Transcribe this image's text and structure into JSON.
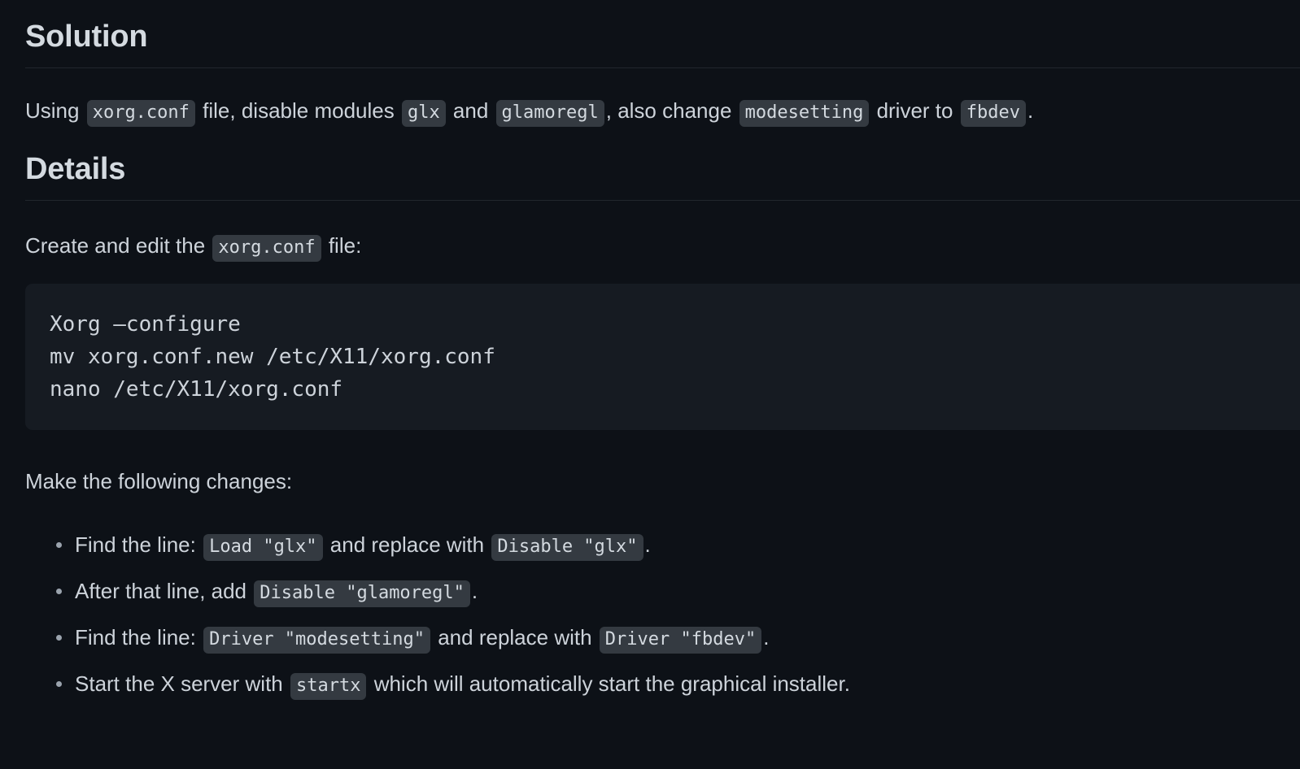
{
  "sections": {
    "solution": {
      "heading": "Solution",
      "paragraph": {
        "part1": "Using ",
        "code1": "xorg.conf",
        "part2": " file, disable modules ",
        "code2": "glx",
        "part3": " and ",
        "code3": "glamoregl",
        "part4": ", also change ",
        "code4": "modesetting",
        "part5": " driver to ",
        "code5": "fbdev",
        "part6": "."
      }
    },
    "details": {
      "heading": "Details",
      "intro": {
        "part1": "Create and edit the ",
        "code1": "xorg.conf",
        "part2": " file:"
      },
      "code_block": "Xorg –configure\nmv xorg.conf.new /etc/X11/xorg.conf\nnano /etc/X11/xorg.conf",
      "changes_label": "Make the following changes:",
      "bullets": [
        {
          "part1": "Find the line: ",
          "code1": "Load \"glx\"",
          "part2": " and replace with ",
          "code2": "Disable \"glx\"",
          "part3": "."
        },
        {
          "part1": "After that line, add ",
          "code1": "Disable \"glamoregl\"",
          "part2": ".",
          "code2": "",
          "part3": ""
        },
        {
          "part1": "Find the line: ",
          "code1": "Driver \"modesetting\"",
          "part2": " and replace with ",
          "code2": "Driver \"fbdev\"",
          "part3": "."
        },
        {
          "part1": "Start the X server with ",
          "code1": "startx",
          "part2": " which will automatically start the graphical installer.",
          "code2": "",
          "part3": ""
        }
      ]
    }
  },
  "colors": {
    "page_background": "#0d1117",
    "code_block_background": "#161b22",
    "inline_code_background": "#343a41",
    "text": "#cdd3da",
    "heading": "#d4dae0",
    "rule": "#21262d"
  }
}
